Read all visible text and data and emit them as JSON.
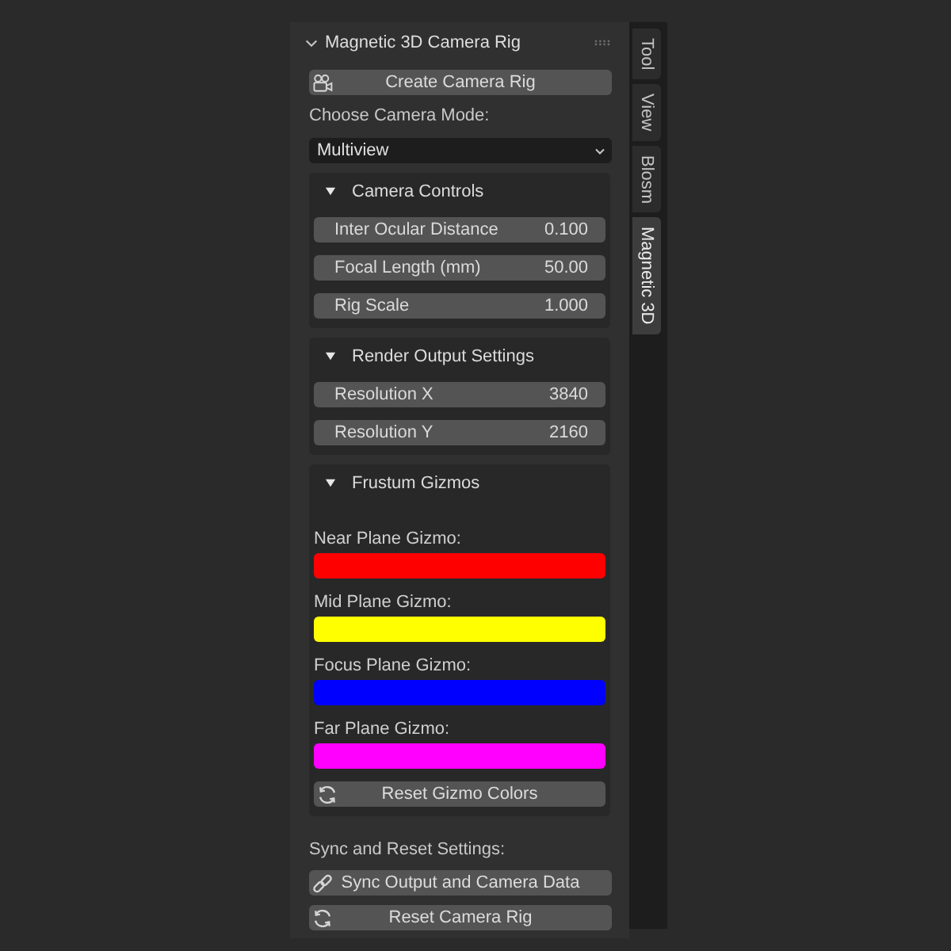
{
  "panel": {
    "title": "Magnetic 3D Camera Rig",
    "expanded": true
  },
  "create_button": {
    "label": "Create Camera Rig"
  },
  "camera_mode": {
    "label": "Choose Camera Mode:",
    "value": "Multiview"
  },
  "subpanels": [
    {
      "title": "Camera Controls",
      "expanded": true,
      "rows": [
        {
          "kind": "field",
          "label": "Inter Ocular Distance",
          "value": "0.100"
        },
        {
          "kind": "field",
          "label": "Focal Length (mm)",
          "value": "50.00"
        },
        {
          "kind": "field",
          "label": "Rig Scale",
          "value": "1.000"
        }
      ]
    },
    {
      "title": "Render Output Settings",
      "expanded": true,
      "rows": [
        {
          "kind": "field",
          "label": "Resolution X",
          "value": "3840"
        },
        {
          "kind": "field",
          "label": "Resolution Y",
          "value": "2160"
        }
      ]
    },
    {
      "title": "Frustum Gizmos",
      "expanded": true,
      "rows": [
        {
          "kind": "color",
          "label": "Near Plane Gizmo:",
          "color": "#ff0000"
        },
        {
          "kind": "color",
          "label": "Mid Plane Gizmo:",
          "color": "#ffff00"
        },
        {
          "kind": "color",
          "label": "Focus Plane Gizmo:",
          "color": "#0000ff"
        },
        {
          "kind": "color",
          "label": "Far Plane Gizmo:",
          "color": "#ff00ff"
        },
        {
          "kind": "button",
          "label": "Reset Gizmo Colors"
        }
      ]
    }
  ],
  "sync_section": {
    "label": "Sync and Reset Settings:",
    "buttons": [
      {
        "label": "Sync Output and Camera Data"
      },
      {
        "label": "Reset Camera Rig"
      }
    ]
  },
  "tabs": [
    {
      "label": "Tool",
      "selected": false
    },
    {
      "label": "View",
      "selected": false
    },
    {
      "label": "Blosm",
      "selected": false
    },
    {
      "label": "Magnetic 3D",
      "selected": true
    }
  ]
}
